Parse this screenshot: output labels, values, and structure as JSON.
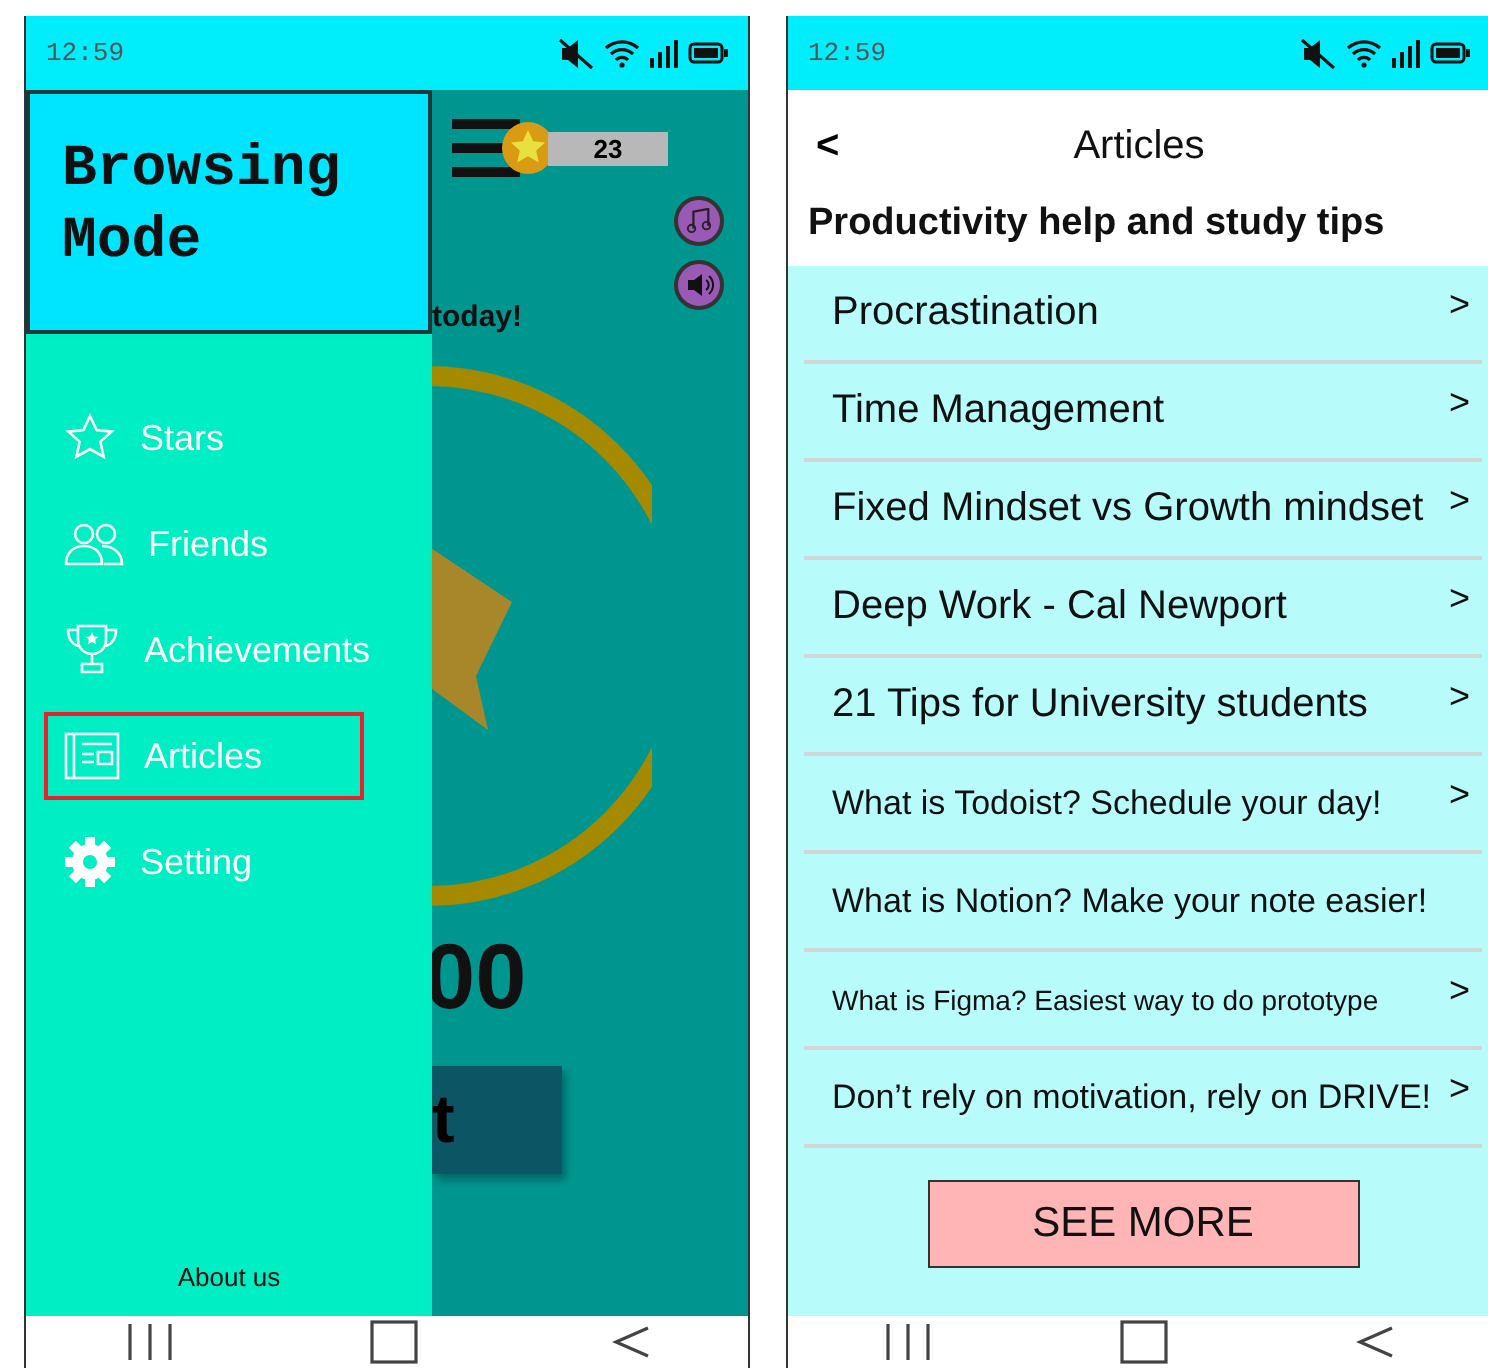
{
  "left_phone": {
    "status_bar": {
      "time": "12:59"
    },
    "drawer": {
      "title": "Browsing Mode",
      "items": [
        {
          "label": "Stars",
          "selected": false
        },
        {
          "label": "Friends",
          "selected": false
        },
        {
          "label": "Achievements",
          "selected": false
        },
        {
          "label": "Articles",
          "selected": true
        },
        {
          "label": "Setting",
          "selected": false
        }
      ],
      "footer": "About us"
    },
    "home_behind": {
      "star_count": "23",
      "banner_fragment": "today!",
      "score_fragment": "00",
      "button_fragment": "t"
    }
  },
  "right_phone": {
    "status_bar": {
      "time": "12:59"
    },
    "header": {
      "back": "<",
      "title": "Articles"
    },
    "heading": "Productivity help and study tips",
    "articles": [
      {
        "title": "Procrastination",
        "chevron": ">",
        "kind": "large"
      },
      {
        "title": "Time Management",
        "chevron": ">",
        "kind": "large"
      },
      {
        "title": "Fixed Mindset vs Growth mindset",
        "chevron": ">",
        "kind": "large"
      },
      {
        "title": "Deep Work - Cal Newport",
        "chevron": ">",
        "kind": "large"
      },
      {
        "title": "21 Tips for University students",
        "chevron": ">",
        "kind": "large"
      },
      {
        "title": "What is Todoist? Schedule your day!",
        "chevron": ">",
        "kind": "small"
      },
      {
        "title": "What is Notion? Make your note easier!",
        "kind": "small"
      },
      {
        "title": "What is Figma? Easiest way to do prototype",
        "chevron": ">",
        "kind": "tiny"
      },
      {
        "title": "Don’t rely on motivation, rely on DRIVE!",
        "chevron": ">",
        "kind": "small"
      }
    ],
    "see_more": "SEE MORE"
  }
}
